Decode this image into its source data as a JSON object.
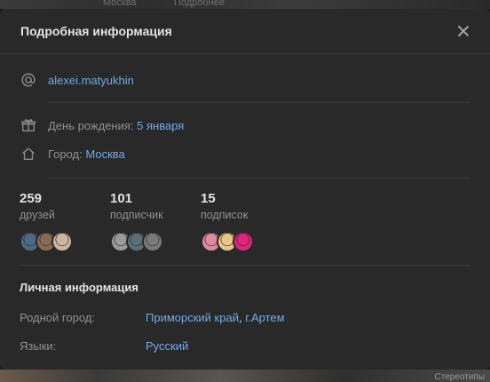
{
  "background": {
    "top_ghost_1": "Москва",
    "top_ghost_2": "Подробнее",
    "bottom_ghost": "Стереотипы"
  },
  "modal": {
    "title": "Подробная информация"
  },
  "profile": {
    "username": "alexei.matyukhin",
    "birthday_label": "День рождения:",
    "birthday_value": "5 января",
    "city_label": "Город:",
    "city_value": "Москва"
  },
  "counters": [
    {
      "number": "259",
      "label": "друзей",
      "avatars": [
        "#4b6a8a",
        "#8a6a55",
        "#c9b7a0"
      ]
    },
    {
      "number": "101",
      "label": "подписчик",
      "avatars": [
        "#9a9a9a",
        "#5a6e7a",
        "#7a7a7a"
      ]
    },
    {
      "number": "15",
      "label": "подписок",
      "avatars": [
        "#e08aa0",
        "#e8c58a",
        "#e0247a"
      ]
    }
  ],
  "personal": {
    "title": "Личная информация",
    "hometown_label": "Родной город:",
    "hometown_value_1": "Приморский край",
    "hometown_sep": ", ",
    "hometown_value_2": "г.Артем",
    "languages_label": "Языки:",
    "languages_value": "Русский"
  },
  "icons": {
    "username": "at-icon",
    "birthday": "gift-icon",
    "city": "home-icon",
    "close": "close-icon"
  }
}
